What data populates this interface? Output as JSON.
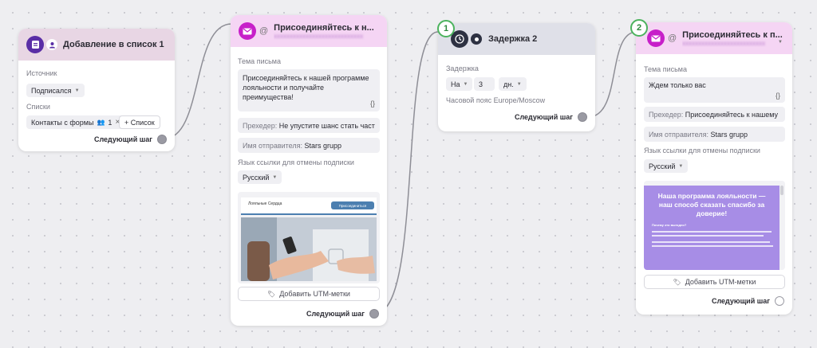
{
  "card1": {
    "title": "Добавление в список 1",
    "source_label": "Источник",
    "source_value": "Подписался",
    "lists_label": "Списки",
    "list_chip": "Контакты с формы",
    "list_count": "1",
    "add_list": "+ Список",
    "next_step": "Следующий шаг"
  },
  "card2": {
    "title": "Присоединяйтесь к н...",
    "subject_label": "Тема письма",
    "subject_value": "Присоединяйтесь к нашей программе лояльности и получайте преимущества!",
    "braces": "{}",
    "preheader_key": "Прехедер:",
    "preheader_value": "Не упустите шанс стать част",
    "sender_key": "Имя отправителя:",
    "sender_value": "Stars grupp",
    "unsub_label": "Язык ссылки для отмены подписки",
    "unsub_value": "Русский",
    "preview_logo": "Лояльные Сердца",
    "preview_button": "Присоединиться",
    "utm_button": "Добавить UTM-метки",
    "next_step": "Следующий шаг"
  },
  "card3": {
    "badge": "1",
    "title": "Задержка 2",
    "delay_label": "Задержка",
    "delay_mode": "На",
    "delay_amount": "3",
    "delay_unit": "дн.",
    "timezone": "Часовой пояс Europe/Moscow",
    "next_step": "Следующий шаг"
  },
  "card4": {
    "badge": "2",
    "title": "Присоединяйтесь к п...",
    "subject_label": "Тема письма",
    "subject_value": "Ждем только вас",
    "braces": "{}",
    "preheader_key": "Прехедер:",
    "preheader_value": "Присоединяйтесь к нашему",
    "sender_key": "Имя отправителя:",
    "sender_value": "Stars grupp",
    "unsub_label": "Язык ссылки для отмены подписки",
    "unsub_value": "Русский",
    "preview_heading": "Наша программа лояльности — наш способ сказать спасибо за доверие!",
    "preview_sub": "Почему это выгодно?",
    "utm_button": "Добавить UTM-метки",
    "next_step": "Следующий шаг"
  },
  "colors": {
    "email_header": "#f5d5f4",
    "list_header": "#e8d6e4",
    "delay_header": "#dfe0e8",
    "email_icon": "#c71fc9",
    "list_icon": "#5a2ea6",
    "delay_icon": "#2d3142",
    "badge_green": "#4cb35e",
    "preview_purple": "#a78de6"
  }
}
